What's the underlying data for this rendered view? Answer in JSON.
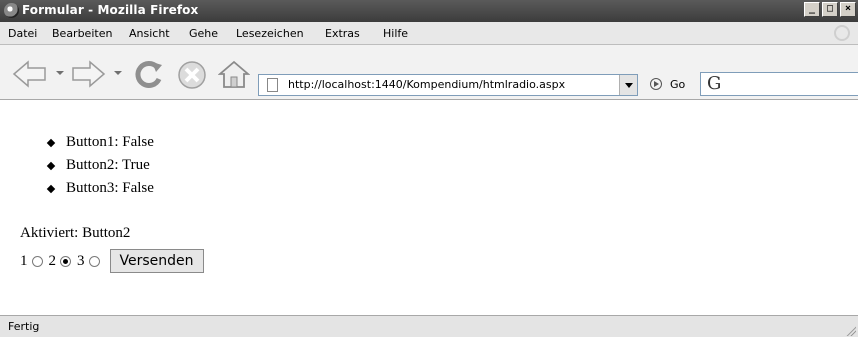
{
  "window": {
    "title": "Formular - Mozilla Firefox"
  },
  "window_controls": {
    "minimize": "_",
    "maximize": "□",
    "close": "×"
  },
  "menu": {
    "items": [
      "Datei",
      "Bearbeiten",
      "Ansicht",
      "Gehe",
      "Lesezeichen",
      "Extras",
      "Hilfe"
    ]
  },
  "toolbar": {
    "url": "http://localhost:1440/Kompendium/htmlradio.aspx",
    "go_label": "Go",
    "search_placeholder": "G"
  },
  "content": {
    "list": [
      "Button1: False",
      "Button2: True",
      "Button3: False"
    ],
    "aktiviert": "Aktiviert: Button2",
    "radios": [
      {
        "label": "1",
        "checked": false
      },
      {
        "label": "2",
        "checked": true
      },
      {
        "label": "3",
        "checked": false
      }
    ],
    "submit_label": "Versenden"
  },
  "status": {
    "text": "Fertig"
  },
  "icons": [
    "firefox-icon",
    "back-icon",
    "forward-icon",
    "reload-icon",
    "stop-icon",
    "home-icon",
    "page-icon",
    "go-icon",
    "google-icon",
    "throbber-icon"
  ]
}
